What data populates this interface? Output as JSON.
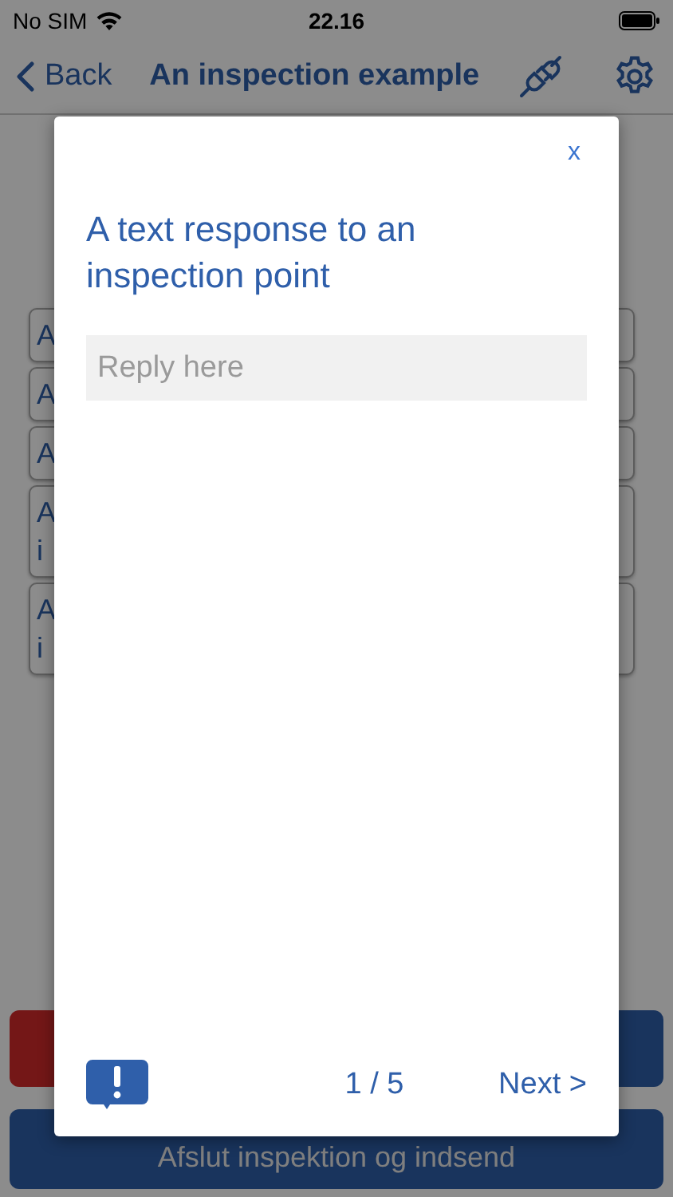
{
  "status_bar": {
    "carrier": "No SIM",
    "time": "22.16"
  },
  "nav": {
    "back": "Back",
    "title": "An inspection example"
  },
  "page": {
    "items": [
      {
        "text": "A"
      },
      {
        "text": "A"
      },
      {
        "text": "A"
      },
      {
        "text": "A i"
      },
      {
        "text": "A i"
      }
    ]
  },
  "action_buttons": [
    {
      "kind": "danger"
    },
    {
      "kind": "primary"
    }
  ],
  "submit_button": "Afslut inspektion og indsend",
  "dialog": {
    "close": "x",
    "question": "A text response to an inspection point",
    "answer": {
      "placeholder": "Reply here"
    },
    "progress": "1 / 5",
    "next": "Next >"
  }
}
